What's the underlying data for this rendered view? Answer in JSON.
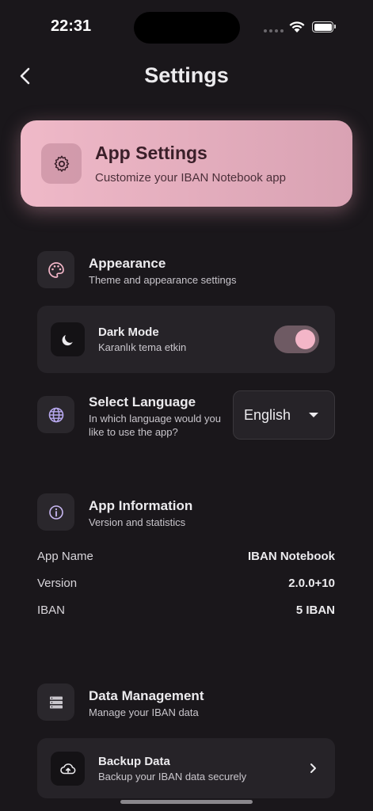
{
  "status": {
    "time": "22:31"
  },
  "header": {
    "title": "Settings"
  },
  "hero": {
    "title": "App Settings",
    "subtitle": "Customize your IBAN Notebook app"
  },
  "appearance": {
    "title": "Appearance",
    "subtitle": "Theme and appearance settings",
    "dark_mode": {
      "title": "Dark Mode",
      "subtitle": "Karanlık tema etkin",
      "enabled": true
    }
  },
  "language": {
    "title": "Select Language",
    "subtitle_line1": "In which language would you",
    "subtitle_line2": "like to use the app?",
    "selected": "English"
  },
  "app_info": {
    "title": "App Information",
    "subtitle": "Version and statistics",
    "rows": [
      {
        "label": "App Name",
        "value": "IBAN Notebook"
      },
      {
        "label": "Version",
        "value": "2.0.0+10"
      },
      {
        "label": "IBAN",
        "value": "5 IBAN"
      }
    ]
  },
  "data_mgmt": {
    "title": "Data Management",
    "subtitle": "Manage your IBAN data",
    "backup": {
      "title": "Backup Data",
      "subtitle": "Backup your IBAN data securely"
    }
  },
  "colors": {
    "background": "#1a171b",
    "accent": "#f3b6c8",
    "hero_gradient_start": "#efb9c8"
  }
}
